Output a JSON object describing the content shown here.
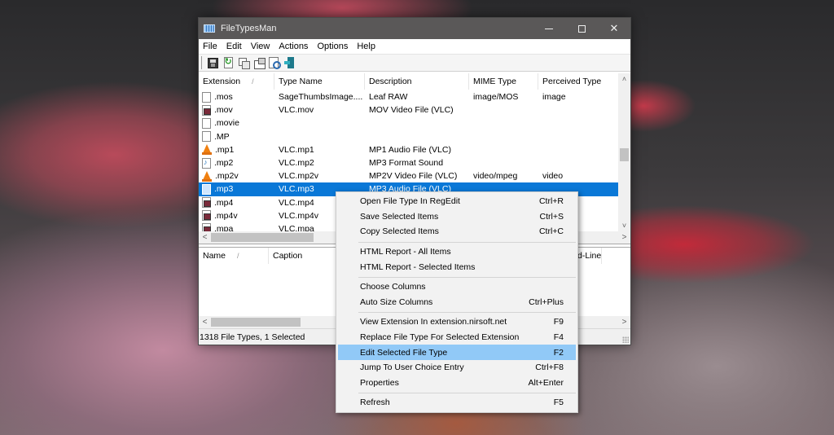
{
  "window": {
    "title": "FileTypesMan",
    "controls": [
      "minimize",
      "maximize",
      "close"
    ]
  },
  "menubar": [
    "File",
    "Edit",
    "View",
    "Actions",
    "Options",
    "Help"
  ],
  "toolbar": [
    {
      "name": "save-icon",
      "tooltip": "Save Selected Items"
    },
    {
      "name": "refresh-icon",
      "tooltip": "Refresh"
    },
    {
      "name": "copy-icon",
      "tooltip": "Copy Selected Items"
    },
    {
      "name": "properties-icon",
      "tooltip": "Properties"
    },
    {
      "name": "find-icon",
      "tooltip": "Find"
    },
    {
      "name": "exit-icon",
      "tooltip": "Exit"
    }
  ],
  "upper_list": {
    "columns": [
      "Extension",
      "Type Name",
      "Description",
      "MIME Type",
      "Perceived Type"
    ],
    "sort_indicator": "/",
    "rows": [
      {
        "icon": "blank",
        "ext": ".mos",
        "type": "SageThumbsImage....",
        "desc": "Leaf RAW",
        "mime": "image/MOS",
        "perceived": "image"
      },
      {
        "icon": "video",
        "ext": ".mov",
        "type": "VLC.mov",
        "desc": "MOV Video File (VLC)",
        "mime": "",
        "perceived": ""
      },
      {
        "icon": "blank",
        "ext": ".movie",
        "type": "",
        "desc": "",
        "mime": "",
        "perceived": ""
      },
      {
        "icon": "blank",
        "ext": ".MP",
        "type": "",
        "desc": "",
        "mime": "",
        "perceived": ""
      },
      {
        "icon": "vlc",
        "ext": ".mp1",
        "type": "VLC.mp1",
        "desc": "MP1 Audio File (VLC)",
        "mime": "",
        "perceived": ""
      },
      {
        "icon": "audio",
        "ext": ".mp2",
        "type": "VLC.mp2",
        "desc": "MP3 Format Sound",
        "mime": "",
        "perceived": ""
      },
      {
        "icon": "vlc",
        "ext": ".mp2v",
        "type": "VLC.mp2v",
        "desc": "MP2V Video File (VLC)",
        "mime": "video/mpeg",
        "perceived": "video"
      },
      {
        "icon": "selected",
        "ext": ".mp3",
        "type": "VLC.mp3",
        "desc": "MP3 Audio File (VLC)",
        "mime": "",
        "perceived": "",
        "selected": true
      },
      {
        "icon": "video",
        "ext": ".mp4",
        "type": "VLC.mp4",
        "desc": "",
        "mime": "",
        "perceived": ""
      },
      {
        "icon": "video",
        "ext": ".mp4v",
        "type": "VLC.mp4v",
        "desc": "",
        "mime": "",
        "perceived": ""
      },
      {
        "icon": "video",
        "ext": ".mpa",
        "type": "VLC.mpa",
        "desc": "",
        "mime": "",
        "perceived": ""
      }
    ]
  },
  "lower_list": {
    "columns": [
      "Name",
      "Caption",
      "d-Line"
    ],
    "sort_indicator": "/"
  },
  "scroll": {
    "up": "˄",
    "down": "˅",
    "left": "<",
    "right": ">"
  },
  "status": {
    "text": "1318 File Types, 1 Selected"
  },
  "context_menu": {
    "groups": [
      [
        {
          "label": "Open File Type In RegEdit",
          "shortcut": "Ctrl+R"
        },
        {
          "label": "Save Selected Items",
          "shortcut": "Ctrl+S"
        },
        {
          "label": "Copy Selected Items",
          "shortcut": "Ctrl+C"
        }
      ],
      [
        {
          "label": "HTML Report - All Items",
          "shortcut": ""
        },
        {
          "label": "HTML Report - Selected Items",
          "shortcut": ""
        }
      ],
      [
        {
          "label": "Choose Columns",
          "shortcut": ""
        },
        {
          "label": "Auto Size Columns",
          "shortcut": "Ctrl+Plus"
        }
      ],
      [
        {
          "label": "View Extension In extension.nirsoft.net",
          "shortcut": "F9"
        },
        {
          "label": "Replace File Type For Selected Extension",
          "shortcut": "F4"
        },
        {
          "label": "Edit Selected File Type",
          "shortcut": "F2",
          "highlighted": true
        },
        {
          "label": "Jump To User Choice Entry",
          "shortcut": "Ctrl+F8"
        },
        {
          "label": "Properties",
          "shortcut": "Alt+Enter"
        }
      ],
      [
        {
          "label": "Refresh",
          "shortcut": "F5"
        }
      ]
    ]
  },
  "colors": {
    "selection": "#0a78d7",
    "menu_highlight": "#91c9f7",
    "titlebar": "#5a5858"
  }
}
